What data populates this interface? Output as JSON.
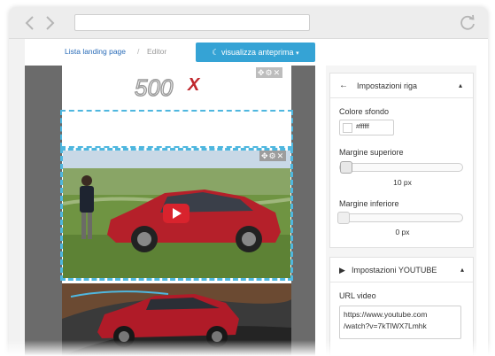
{
  "toolbar": {
    "breadcrumb_link": "Lista landing page",
    "breadcrumb_sep": "/",
    "breadcrumb_current": "Editor",
    "preview_label": "visualizza anteprima",
    "preview_caret": "▾"
  },
  "canvas": {
    "logo_text": "500",
    "logo_x": "X",
    "row_tools": "✥⚙✕"
  },
  "sidebar": {
    "row_panel": {
      "back_icon": "←",
      "title": "Impostazioni riga",
      "caret": "▴",
      "bg_label": "Colore sfondo",
      "bg_value": "#ffffff",
      "top_margin_label": "Margine superiore",
      "top_margin_value": "10 px",
      "top_margin_fraction": 0.05,
      "bottom_margin_label": "Margine inferiore",
      "bottom_margin_value": "0 px",
      "bottom_margin_fraction": 0.0
    },
    "youtube_panel": {
      "title": "Impostazioni YOUTUBE",
      "caret": "▴",
      "url_label": "URL video",
      "url_line1": "https://www.youtube.com",
      "url_line2": "/watch?v=7kTlWX7Lmhk"
    }
  },
  "colors": {
    "accent": "#35a3d5",
    "dashed_outline": "#4fb7df",
    "editor_bg": "#6b6b6b",
    "play_button": "#d9232d"
  }
}
